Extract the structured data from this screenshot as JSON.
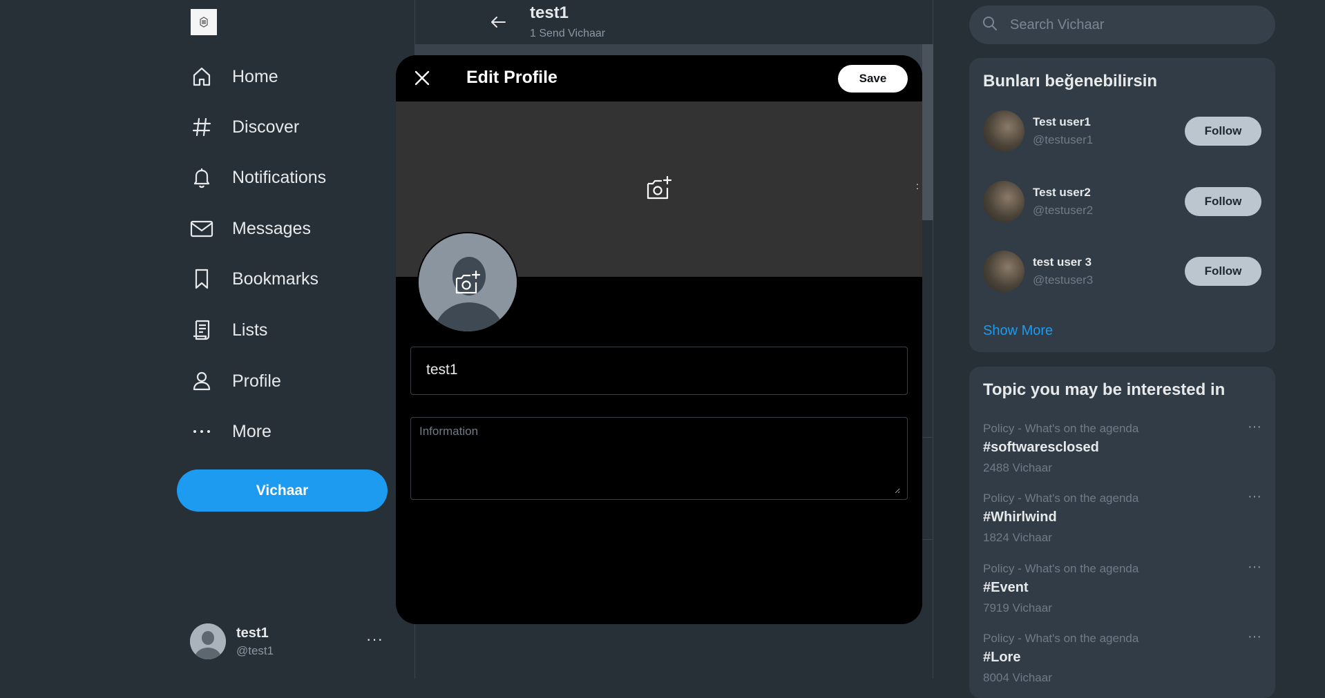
{
  "sidebar": {
    "items": [
      {
        "label": "Home",
        "icon": "home-icon"
      },
      {
        "label": "Discover",
        "icon": "hashtag-icon"
      },
      {
        "label": "Notifications",
        "icon": "bell-icon"
      },
      {
        "label": "Messages",
        "icon": "envelope-icon"
      },
      {
        "label": "Bookmarks",
        "icon": "bookmark-icon"
      },
      {
        "label": "Lists",
        "icon": "list-icon"
      },
      {
        "label": "Profile",
        "icon": "person-icon"
      },
      {
        "label": "More",
        "icon": "more-dots-icon"
      }
    ],
    "post_button": "Vichaar",
    "account": {
      "name": "test1",
      "handle": "@test1",
      "menu": "···"
    }
  },
  "center": {
    "title": "test1",
    "subtitle": "1 Send Vichaar"
  },
  "modal": {
    "title": "Edit Profile",
    "save_label": "Save",
    "name_value": "test1",
    "info_placeholder": "Information",
    "banner_edge": ":"
  },
  "right": {
    "search_placeholder": "Search Vichaar",
    "suggestions": {
      "title": "Bunları beğenebilirsin",
      "users": [
        {
          "name": "Test user1",
          "handle": "@testuser1",
          "button": "Follow"
        },
        {
          "name": "Test user2",
          "handle": "@testuser2",
          "button": "Follow"
        },
        {
          "name": "test user 3",
          "handle": "@testuser3",
          "button": "Follow"
        }
      ],
      "show_more": "Show More"
    },
    "topics": {
      "title": "Topic you may be interested in",
      "items": [
        {
          "category": "Policy - What's on the agenda",
          "tag": "#softwaresclosed",
          "count": "2488 Vichaar"
        },
        {
          "category": "Policy - What's on the agenda",
          "tag": "#Whirlwind",
          "count": "1824 Vichaar"
        },
        {
          "category": "Policy - What's on the agenda",
          "tag": "#Event",
          "count": "7919 Vichaar"
        },
        {
          "category": "Policy - What's on the agenda",
          "tag": "#Lore",
          "count": "8004 Vichaar"
        }
      ],
      "menu": "···"
    }
  },
  "colors": {
    "accent": "#1d9bf0",
    "background": "#272f37",
    "modal": "#000000"
  }
}
